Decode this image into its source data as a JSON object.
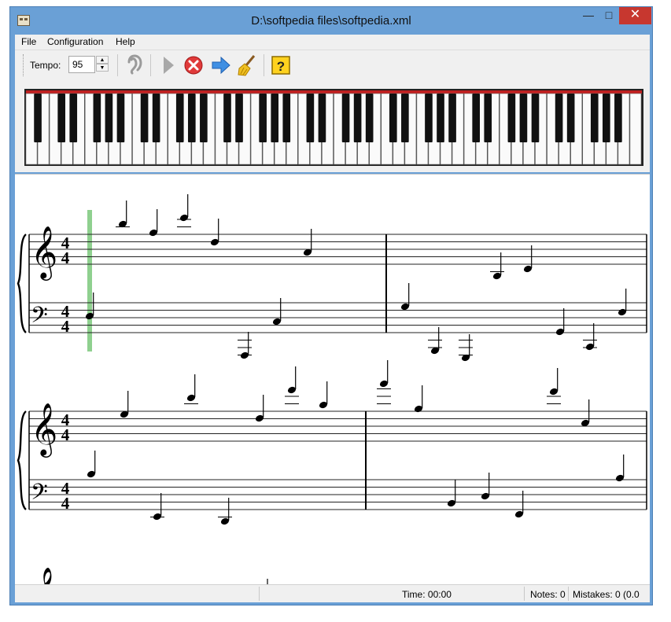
{
  "window": {
    "title": "D:\\softpedia files\\softpedia.xml"
  },
  "menu": [
    "File",
    "Configuration",
    "Help"
  ],
  "toolbar": {
    "tempo_label": "Tempo:",
    "tempo_value": "95"
  },
  "status": {
    "time": "Time: 00:00",
    "notes": "Notes: 0",
    "mistakes": "Mistakes: 0 (0.0"
  },
  "icons": {
    "listen": "ear-icon",
    "play": "play-icon",
    "stop": "stop-icon",
    "forward": "arrow-right-icon",
    "clear": "broom-icon",
    "help": "help-icon"
  },
  "colors": {
    "cursor": "#8fd08f",
    "close": "#c7372f",
    "stop": "#e03a3a",
    "help": "#ffd21f"
  }
}
